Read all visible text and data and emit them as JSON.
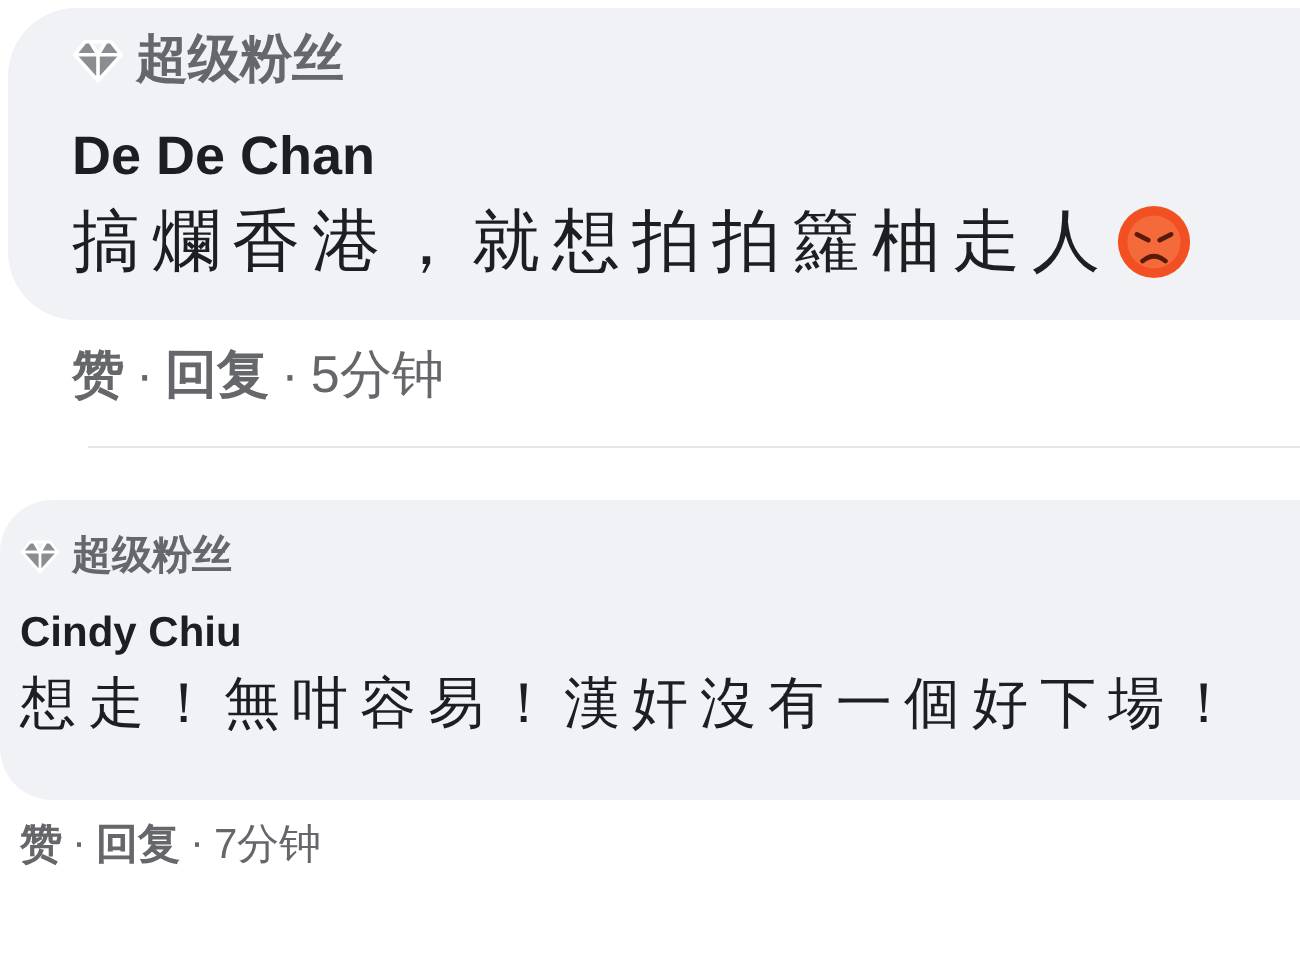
{
  "comments": [
    {
      "kind": "large",
      "badge": "超级粉丝",
      "author": "De De Chan",
      "text": "搞爛香港，就想拍拍籮柚走人",
      "has_emoji": true,
      "actions": [
        "赞",
        "回复"
      ],
      "separator": "·",
      "time": "5分钟"
    },
    {
      "kind": "compact",
      "badge": "超级粉丝",
      "author": "Cindy Chiu",
      "text": "想走！無咁容易！漢奸沒有一個好下場！",
      "has_emoji": false,
      "actions": [
        "赞",
        "回复"
      ],
      "separator": "·",
      "time": "7分钟"
    }
  ]
}
